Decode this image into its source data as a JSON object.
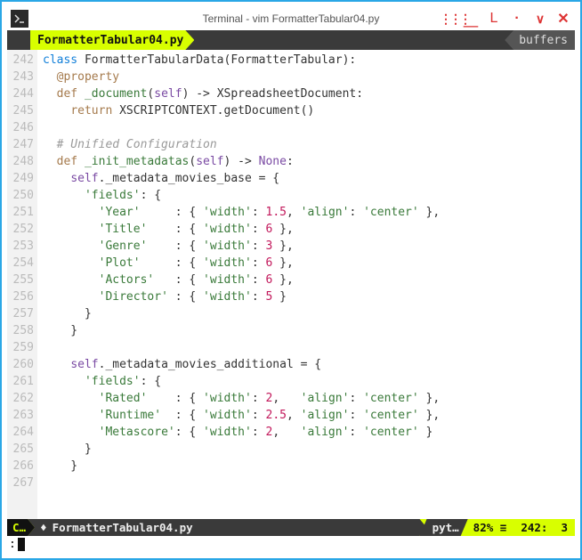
{
  "window": {
    "title": "Terminal - vim FormatterTabular04.py"
  },
  "tabs": {
    "active": "FormatterTabular04.py",
    "buffers_label": "buffers"
  },
  "gutter_start": 242,
  "code_lines": [
    {
      "n": 242,
      "segs": [
        [
          "kw-blue",
          "class "
        ],
        [
          "typ",
          "FormatterTabularData"
        ],
        [
          "paren",
          "("
        ],
        [
          "typ",
          "FormatterTabular"
        ],
        [
          "paren",
          ")"
        ],
        [
          "paren",
          ":"
        ]
      ]
    },
    {
      "n": 243,
      "segs": [
        [
          "plain",
          "  "
        ],
        [
          "kw-deco",
          "@property"
        ]
      ]
    },
    {
      "n": 244,
      "segs": [
        [
          "plain",
          "  "
        ],
        [
          "kw-tan",
          "def "
        ],
        [
          "fn-name",
          "_document"
        ],
        [
          "paren",
          "("
        ],
        [
          "builtin",
          "self"
        ],
        [
          "paren",
          ")"
        ],
        [
          "plain",
          " -> XSpreadsheetDocument:"
        ]
      ]
    },
    {
      "n": 245,
      "segs": [
        [
          "plain",
          "    "
        ],
        [
          "kw-tan",
          "return"
        ],
        [
          "plain",
          " XSCRIPTCONTEXT.getDocument()"
        ]
      ]
    },
    {
      "n": 246,
      "segs": []
    },
    {
      "n": 247,
      "segs": [
        [
          "plain",
          "  "
        ],
        [
          "cmt",
          "# Unified Configuration"
        ]
      ]
    },
    {
      "n": 248,
      "segs": [
        [
          "plain",
          "  "
        ],
        [
          "kw-tan",
          "def "
        ],
        [
          "fn-name",
          "_init_metadatas"
        ],
        [
          "paren",
          "("
        ],
        [
          "builtin",
          "self"
        ],
        [
          "paren",
          ")"
        ],
        [
          "plain",
          " -> "
        ],
        [
          "builtin",
          "None"
        ],
        [
          "plain",
          ":"
        ]
      ]
    },
    {
      "n": 249,
      "segs": [
        [
          "plain",
          "    "
        ],
        [
          "builtin",
          "self"
        ],
        [
          "plain",
          "._metadata_movies_base = {"
        ]
      ]
    },
    {
      "n": 250,
      "segs": [
        [
          "plain",
          "      "
        ],
        [
          "str",
          "'fields'"
        ],
        [
          "plain",
          ": {"
        ]
      ]
    },
    {
      "n": 251,
      "segs": [
        [
          "plain",
          "        "
        ],
        [
          "str",
          "'Year'"
        ],
        [
          "plain",
          "     : { "
        ],
        [
          "str",
          "'width'"
        ],
        [
          "plain",
          ": "
        ],
        [
          "num",
          "1.5"
        ],
        [
          "plain",
          ", "
        ],
        [
          "str",
          "'align'"
        ],
        [
          "plain",
          ": "
        ],
        [
          "str",
          "'center'"
        ],
        [
          "plain",
          " },"
        ]
      ]
    },
    {
      "n": 252,
      "segs": [
        [
          "plain",
          "        "
        ],
        [
          "str",
          "'Title'"
        ],
        [
          "plain",
          "    : { "
        ],
        [
          "str",
          "'width'"
        ],
        [
          "plain",
          ": "
        ],
        [
          "num",
          "6"
        ],
        [
          "plain",
          " },"
        ]
      ]
    },
    {
      "n": 253,
      "segs": [
        [
          "plain",
          "        "
        ],
        [
          "str",
          "'Genre'"
        ],
        [
          "plain",
          "    : { "
        ],
        [
          "str",
          "'width'"
        ],
        [
          "plain",
          ": "
        ],
        [
          "num",
          "3"
        ],
        [
          "plain",
          " },"
        ]
      ]
    },
    {
      "n": 254,
      "segs": [
        [
          "plain",
          "        "
        ],
        [
          "str",
          "'Plot'"
        ],
        [
          "plain",
          "     : { "
        ],
        [
          "str",
          "'width'"
        ],
        [
          "plain",
          ": "
        ],
        [
          "num",
          "6"
        ],
        [
          "plain",
          " },"
        ]
      ]
    },
    {
      "n": 255,
      "segs": [
        [
          "plain",
          "        "
        ],
        [
          "str",
          "'Actors'"
        ],
        [
          "plain",
          "   : { "
        ],
        [
          "str",
          "'width'"
        ],
        [
          "plain",
          ": "
        ],
        [
          "num",
          "6"
        ],
        [
          "plain",
          " },"
        ]
      ]
    },
    {
      "n": 256,
      "segs": [
        [
          "plain",
          "        "
        ],
        [
          "str",
          "'Director'"
        ],
        [
          "plain",
          " : { "
        ],
        [
          "str",
          "'width'"
        ],
        [
          "plain",
          ": "
        ],
        [
          "num",
          "5"
        ],
        [
          "plain",
          " }"
        ]
      ]
    },
    {
      "n": 257,
      "segs": [
        [
          "plain",
          "      }"
        ]
      ]
    },
    {
      "n": 258,
      "segs": [
        [
          "plain",
          "    }"
        ]
      ]
    },
    {
      "n": 259,
      "segs": []
    },
    {
      "n": 260,
      "segs": [
        [
          "plain",
          "    "
        ],
        [
          "builtin",
          "self"
        ],
        [
          "plain",
          "._metadata_movies_additional = {"
        ]
      ]
    },
    {
      "n": 261,
      "segs": [
        [
          "plain",
          "      "
        ],
        [
          "str",
          "'fields'"
        ],
        [
          "plain",
          ": {"
        ]
      ]
    },
    {
      "n": 262,
      "segs": [
        [
          "plain",
          "        "
        ],
        [
          "str",
          "'Rated'"
        ],
        [
          "plain",
          "    : { "
        ],
        [
          "str",
          "'width'"
        ],
        [
          "plain",
          ": "
        ],
        [
          "num",
          "2"
        ],
        [
          "plain",
          ",   "
        ],
        [
          "str",
          "'align'"
        ],
        [
          "plain",
          ": "
        ],
        [
          "str",
          "'center'"
        ],
        [
          "plain",
          " },"
        ]
      ]
    },
    {
      "n": 263,
      "segs": [
        [
          "plain",
          "        "
        ],
        [
          "str",
          "'Runtime'"
        ],
        [
          "plain",
          "  : { "
        ],
        [
          "str",
          "'width'"
        ],
        [
          "plain",
          ": "
        ],
        [
          "num",
          "2.5"
        ],
        [
          "plain",
          ", "
        ],
        [
          "str",
          "'align'"
        ],
        [
          "plain",
          ": "
        ],
        [
          "str",
          "'center'"
        ],
        [
          "plain",
          " },"
        ]
      ]
    },
    {
      "n": 264,
      "segs": [
        [
          "plain",
          "        "
        ],
        [
          "str",
          "'Metascore'"
        ],
        [
          "plain",
          ": { "
        ],
        [
          "str",
          "'width'"
        ],
        [
          "plain",
          ": "
        ],
        [
          "num",
          "2"
        ],
        [
          "plain",
          ",   "
        ],
        [
          "str",
          "'align'"
        ],
        [
          "plain",
          ": "
        ],
        [
          "str",
          "'center'"
        ],
        [
          "plain",
          " }"
        ]
      ]
    },
    {
      "n": 265,
      "segs": [
        [
          "plain",
          "      }"
        ]
      ]
    },
    {
      "n": 266,
      "segs": [
        [
          "plain",
          "    }"
        ]
      ]
    },
    {
      "n": 267,
      "segs": []
    }
  ],
  "status": {
    "mode": "C…",
    "file": "FormatterTabular04.py",
    "filetype": "pyt…",
    "percent": "82%",
    "sep": "≡",
    "line": "242",
    "col": "3"
  },
  "cmd": ":"
}
